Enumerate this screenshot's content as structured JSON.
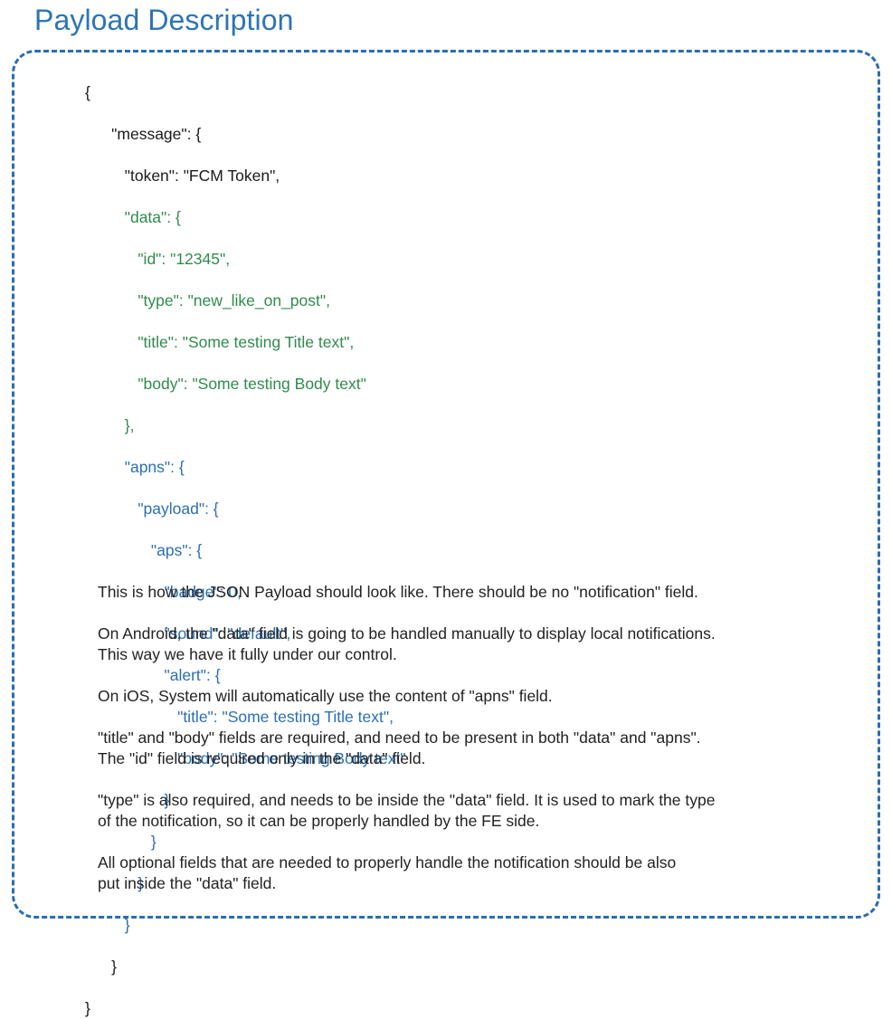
{
  "page": {
    "title": "Payload Description"
  },
  "code": {
    "language": "json",
    "lines": [
      {
        "indent": 0,
        "text": "{",
        "color": "plain"
      },
      {
        "indent": 2,
        "text": "\"message\": {",
        "color": "plain"
      },
      {
        "indent": 3,
        "text": "\"token\": \"FCM Token\",",
        "color": "plain"
      },
      {
        "indent": 3,
        "text": "\"data\": {",
        "color": "green"
      },
      {
        "indent": 4,
        "text": "\"id\": \"12345\",",
        "color": "green"
      },
      {
        "indent": 4,
        "text": "\"type\": \"new_like_on_post\",",
        "color": "green"
      },
      {
        "indent": 4,
        "text": "\"title\": \"Some testing Title text\",",
        "color": "green"
      },
      {
        "indent": 4,
        "text": "\"body\": \"Some testing Body text\"",
        "color": "green"
      },
      {
        "indent": 3,
        "text": "},",
        "color": "green"
      },
      {
        "indent": 3,
        "text": "\"apns\": {",
        "color": "blue"
      },
      {
        "indent": 4,
        "text": "\"payload\": {",
        "color": "blue"
      },
      {
        "indent": 5,
        "text": "\"aps\": {",
        "color": "blue"
      },
      {
        "indent": 6,
        "text": "\"badge\": 0,",
        "color": "blue"
      },
      {
        "indent": 6,
        "text": "\"sound\": \"default\",",
        "color": "blue"
      },
      {
        "indent": 6,
        "text": "\"alert\": {",
        "color": "blue"
      },
      {
        "indent": 7,
        "text": "\"title\": \"Some testing Title text\",",
        "color": "blue"
      },
      {
        "indent": 7,
        "text": "\"body\": \"Some testing Body text\"",
        "color": "blue"
      },
      {
        "indent": 6,
        "text": "}",
        "color": "blue"
      },
      {
        "indent": 5,
        "text": "}",
        "color": "blue"
      },
      {
        "indent": 4,
        "text": "}",
        "color": "blue"
      },
      {
        "indent": 3,
        "text": "}",
        "color": "blue"
      },
      {
        "indent": 2,
        "text": "}",
        "color": "plain"
      },
      {
        "indent": 0,
        "text": "}",
        "color": "plain"
      }
    ]
  },
  "description": {
    "paragraphs": [
      "This is how the JSON Payload should look like. There should be no \"notification\" field.",
      "On Android, the \"data\" field is going to be handled manually to display local notifications.\nThis way we have it fully under our control.",
      "On iOS, System will automatically use the content of \"apns\" field.",
      "\"title\" and \"body\" fields are required, and need to be present in both \"data\" and \"apns\".\nThe \"id\" field is required only in the \"data\" field.",
      "\"type\" is also required, and needs to be inside the \"data\" field. It is used to mark the type\nof the notification, so it can be properly handled by the FE side.",
      "All optional fields that are needed to properly handle the notification should be also\nput inside the \"data\" field."
    ]
  },
  "colors": {
    "title": "#2d74b5",
    "border": "#2a6db0",
    "code_plain": "#1a1a1a",
    "code_green": "#2f8b4c",
    "code_blue": "#2a6fb3",
    "body_text": "#222222",
    "background": "#ffffff"
  }
}
